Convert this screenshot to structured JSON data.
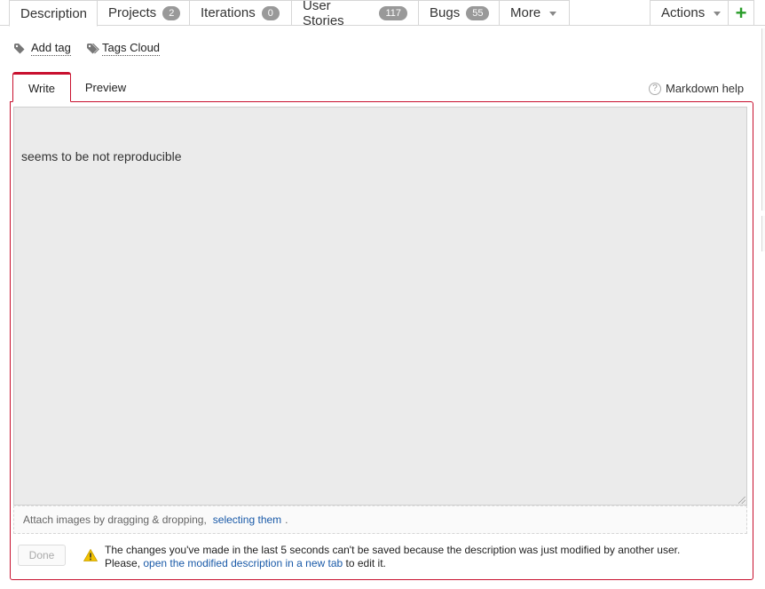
{
  "tabs": [
    {
      "label": "Description",
      "badge": null
    },
    {
      "label": "Projects",
      "badge": "2"
    },
    {
      "label": "Iterations",
      "badge": "0"
    },
    {
      "label": "User Stories",
      "badge": "117"
    },
    {
      "label": "Bugs",
      "badge": "55"
    },
    {
      "label": "More",
      "badge": null
    }
  ],
  "actions_label": "Actions",
  "add_icon": "+",
  "tags": {
    "add_tag": "Add tag",
    "tags_cloud": "Tags Cloud"
  },
  "editor": {
    "write_tab": "Write",
    "preview_tab": "Preview",
    "markdown_help": "Markdown help",
    "content": "seems to be not reproducible",
    "attach_text": "Attach images by dragging & dropping,",
    "attach_link": "selecting them",
    "attach_end": ".",
    "done_label": "Done"
  },
  "warning": {
    "line1": "The changes you've made in the last 5 seconds can't be saved because the description was just modified by another user.",
    "line2_prefix": "Please,",
    "line2_link": "open the modified description in a new tab",
    "line2_suffix": "to edit it."
  },
  "colors": {
    "accent": "#c8102e",
    "link": "#1a5aa8",
    "add": "#2a9d2a",
    "badge": "#999999",
    "warning": "#f2c200"
  },
  "icons": {
    "tag": "tag-icon",
    "tags_cloud": "tags-icon",
    "help": "question-circle-icon",
    "warning": "warning-triangle-icon",
    "caret": "caret-down-icon",
    "add": "plus-icon"
  }
}
